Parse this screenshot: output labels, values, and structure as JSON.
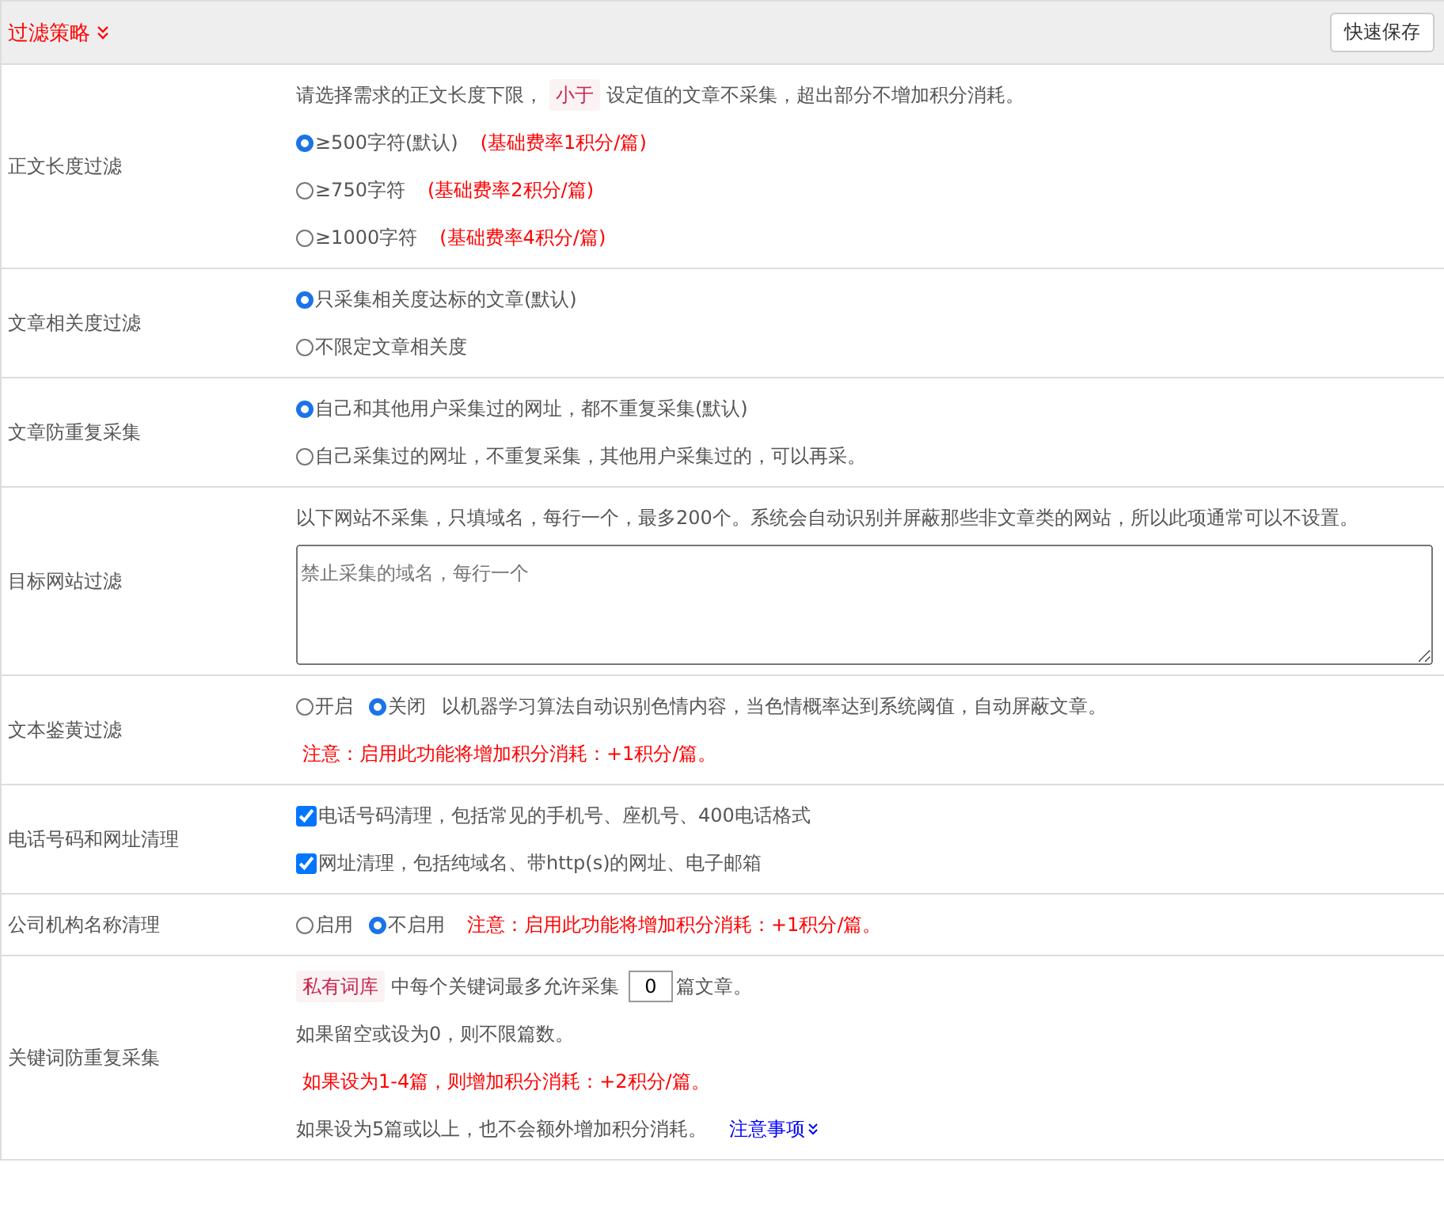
{
  "header": {
    "title": "过滤策略",
    "save_button": "快速保存"
  },
  "rows": [
    {
      "label": "正文长度过滤",
      "lines": [
        [
          {
            "kind": "text",
            "text": "请选择需求的正文长度下限，"
          },
          {
            "kind": "tag",
            "text": "小于"
          },
          {
            "kind": "text",
            "text": "设定值的文章不采集，超出部分不增加积分消耗。"
          }
        ],
        [
          {
            "kind": "radio",
            "text": "≥500字符(默认)",
            "selected": true
          },
          {
            "kind": "note",
            "text": "(基础费率1积分/篇)"
          }
        ],
        [
          {
            "kind": "radio",
            "text": "≥750字符",
            "selected": false
          },
          {
            "kind": "note",
            "text": "(基础费率2积分/篇)"
          }
        ],
        [
          {
            "kind": "radio",
            "text": "≥1000字符",
            "selected": false
          },
          {
            "kind": "note",
            "text": "(基础费率4积分/篇)"
          }
        ]
      ]
    },
    {
      "label": "文章相关度过滤",
      "lines": [
        [
          {
            "kind": "radio",
            "text": "只采集相关度达标的文章(默认)",
            "selected": true
          }
        ],
        [
          {
            "kind": "radio",
            "text": "不限定文章相关度",
            "selected": false
          }
        ]
      ]
    },
    {
      "label": "文章防重复采集",
      "lines": [
        [
          {
            "kind": "radio",
            "text": "自己和其他用户采集过的网址，都不重复采集(默认)",
            "selected": true
          }
        ],
        [
          {
            "kind": "radio",
            "text": "自己采集过的网址，不重复采集，其他用户采集过的，可以再采。",
            "selected": false
          }
        ]
      ]
    },
    {
      "label": "目标网站过滤",
      "lines": [
        [
          {
            "kind": "text",
            "text": "以下网站不采集，只填域名，每行一个，最多200个。系统会自动识别并屏蔽那些非文章类的网站，所以此项通常可以不设置。"
          }
        ],
        [
          {
            "kind": "textarea",
            "placeholder": "禁止采集的域名，每行一个"
          }
        ]
      ]
    },
    {
      "label": "文本鉴黄过滤",
      "lines": [
        [
          {
            "kind": "radio",
            "text": "开启",
            "selected": false
          },
          {
            "kind": "radio",
            "text": "关闭",
            "selected": true
          },
          {
            "kind": "text",
            "text": "以机器学习算法自动识别色情内容，当色情概率达到系统阈值，自动屏蔽文章。"
          }
        ],
        [
          {
            "kind": "note",
            "text": "注意：启用此功能将增加积分消耗：+1积分/篇。"
          }
        ]
      ]
    },
    {
      "label": "电话号码和网址清理",
      "lines": [
        [
          {
            "kind": "checkbox",
            "text": "电话号码清理，包括常见的手机号、座机号、400电话格式",
            "checked": true
          }
        ],
        [
          {
            "kind": "checkbox",
            "text": "网址清理，包括纯域名、带http(s)的网址、电子邮箱",
            "checked": true
          }
        ]
      ]
    },
    {
      "label": "公司机构名称清理",
      "lines": [
        [
          {
            "kind": "radio",
            "text": "启用",
            "selected": false
          },
          {
            "kind": "radio",
            "text": "不启用",
            "selected": true
          },
          {
            "kind": "note",
            "text": "注意：启用此功能将增加积分消耗：+1积分/篇。"
          }
        ]
      ]
    },
    {
      "label": "关键词防重复采集",
      "lines": [
        [
          {
            "kind": "tag",
            "text": "私有词库"
          },
          {
            "kind": "text",
            "text": "中每个关键词最多允许采集"
          },
          {
            "kind": "input",
            "value": "0"
          },
          {
            "kind": "text",
            "text": "篇文章。"
          }
        ],
        [
          {
            "kind": "text",
            "text": "如果留空或设为0，则不限篇数。"
          }
        ],
        [
          {
            "kind": "note",
            "text": "如果设为1-4篇，则增加积分消耗：+2积分/篇。"
          }
        ],
        [
          {
            "kind": "text",
            "text": "如果设为5篇或以上，也不会额外增加积分消耗。"
          },
          {
            "kind": "link",
            "text": "注意事项"
          }
        ]
      ]
    }
  ]
}
